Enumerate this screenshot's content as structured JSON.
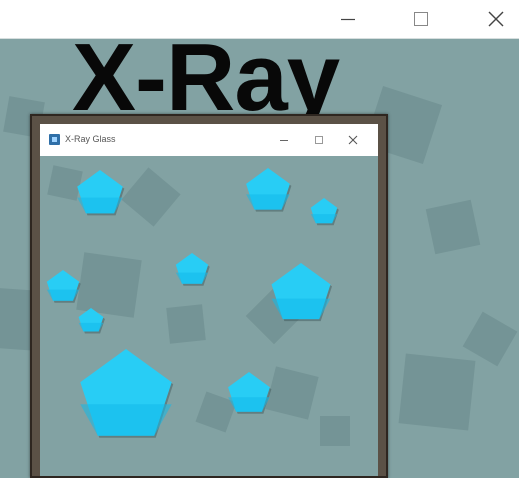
{
  "outer_window": {
    "title": "",
    "controls": [
      "minimize-icon",
      "maximize-icon",
      "close-icon"
    ]
  },
  "app": {
    "heading": "X-Ray"
  },
  "inner_window": {
    "title": "X-Ray Glass",
    "controls": [
      "minimize-icon",
      "maximize-icon",
      "close-icon"
    ]
  },
  "colors": {
    "background": "#82a2a3",
    "gem_fill": "#28cdf5",
    "gem_shade": "#13b9ea",
    "frame": "#5b5146"
  },
  "icons": {
    "gem": "pentagon-gem-icon",
    "app": "xray-app-icon"
  }
}
